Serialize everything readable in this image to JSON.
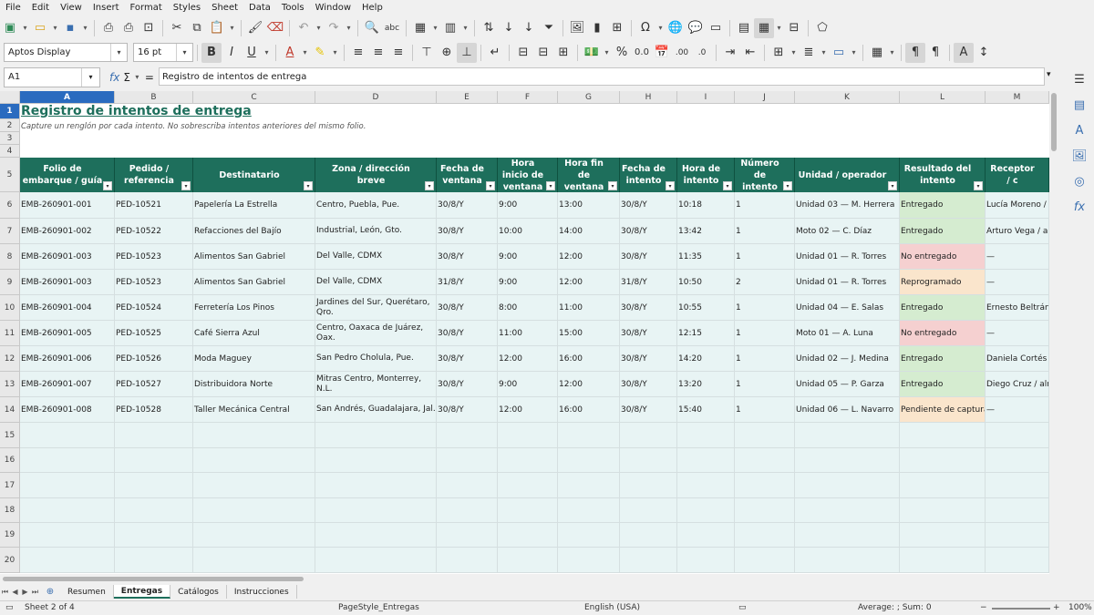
{
  "menu": [
    "File",
    "Edit",
    "View",
    "Insert",
    "Format",
    "Styles",
    "Sheet",
    "Data",
    "Tools",
    "Window",
    "Help"
  ],
  "formatting": {
    "font_name": "Aptos Display",
    "font_size": "16 pt",
    "bold_label": "B",
    "italic_label": "I",
    "underline_label": "U"
  },
  "formula_bar": {
    "cell_ref": "A1",
    "content": "Registro de intentos de entrega",
    "fx_symbol": "fx",
    "sum_symbol": "Σ",
    "eq_symbol": "="
  },
  "columns": [
    "A",
    "B",
    "C",
    "D",
    "E",
    "F",
    "G",
    "H",
    "I",
    "J",
    "K",
    "L",
    "M"
  ],
  "selected_column": "A",
  "sheet": {
    "title": "Registro de intentos de entrega",
    "subtitle": "Capture un renglón por cada intento. No sobrescriba intentos anteriores del mismo folio.",
    "headers": [
      "Folio de embarque / guía",
      "Pedido / referencia",
      "Destinatario",
      "Zona / dirección breve",
      "Fecha de ventana",
      "Hora inicio de ventana",
      "Hora fin de ventana",
      "Fecha de intento",
      "Hora de intento",
      "Número de intento",
      "Unidad / operador",
      "Resultado del intento",
      "Receptor / c"
    ],
    "rows": [
      [
        "EMB-260901-001",
        "PED-10521",
        "Papelería La Estrella",
        "Centro, Puebla, Pue.",
        "30/8/Y",
        "9:00",
        "13:00",
        "30/8/Y",
        "10:18",
        "1",
        "Unidad 03 — M. Herrera",
        "Entregado",
        "Lucía Moreno / e"
      ],
      [
        "EMB-260901-002",
        "PED-10522",
        "Refacciones del Bajío",
        "Industrial, León, Gto.",
        "30/8/Y",
        "10:00",
        "14:00",
        "30/8/Y",
        "13:42",
        "1",
        "Moto 02 — C. Díaz",
        "Entregado",
        "Arturo Vega / alm"
      ],
      [
        "EMB-260901-003",
        "PED-10523",
        "Alimentos San Gabriel",
        "Del Valle, CDMX",
        "30/8/Y",
        "9:00",
        "12:00",
        "30/8/Y",
        "11:35",
        "1",
        "Unidad 01 — R. Torres",
        "No entregado",
        "—"
      ],
      [
        "EMB-260901-003",
        "PED-10523",
        "Alimentos San Gabriel",
        "Del Valle, CDMX",
        "31/8/Y",
        "9:00",
        "12:00",
        "31/8/Y",
        "10:50",
        "2",
        "Unidad 01 — R. Torres",
        "Reprogramado",
        "—"
      ],
      [
        "EMB-260901-004",
        "PED-10524",
        "Ferretería Los Pinos",
        "Jardines del Sur, Querétaro, Qro.",
        "30/8/Y",
        "8:00",
        "11:00",
        "30/8/Y",
        "10:55",
        "1",
        "Unidad 04 — E. Salas",
        "Entregado",
        "Ernesto Beltrán /"
      ],
      [
        "EMB-260901-005",
        "PED-10525",
        "Café Sierra Azul",
        "Centro, Oaxaca de Juárez, Oax.",
        "30/8/Y",
        "11:00",
        "15:00",
        "30/8/Y",
        "12:15",
        "1",
        "Moto 01 — A. Luna",
        "No entregado",
        "—"
      ],
      [
        "EMB-260901-006",
        "PED-10526",
        "Moda Maguey",
        "San Pedro Cholula, Pue.",
        "30/8/Y",
        "12:00",
        "16:00",
        "30/8/Y",
        "14:20",
        "1",
        "Unidad 02 — J. Medina",
        "Entregado",
        "Daniela Cortés /"
      ],
      [
        "EMB-260901-007",
        "PED-10527",
        "Distribuidora Norte",
        "Mitras Centro, Monterrey, N.L.",
        "30/8/Y",
        "9:00",
        "12:00",
        "30/8/Y",
        "13:20",
        "1",
        "Unidad 05 — P. Garza",
        "Entregado",
        "Diego Cruz / alm"
      ],
      [
        "EMB-260901-008",
        "PED-10528",
        "Taller Mecánica Central",
        "San Andrés, Guadalajara, Jal.",
        "30/8/Y",
        "12:00",
        "16:00",
        "30/8/Y",
        "15:40",
        "1",
        "Unidad 06 — L. Navarro",
        "Pendiente de captura",
        "—"
      ]
    ],
    "result_status": [
      "ok",
      "ok",
      "no",
      "re",
      "ok",
      "no",
      "ok",
      "ok",
      "re"
    ],
    "row_numbers": [
      "1",
      "2",
      "3",
      "4",
      "5",
      "6",
      "7",
      "8",
      "9",
      "10",
      "11",
      "12",
      "13",
      "14",
      "15",
      "16",
      "17",
      "18",
      "19",
      "20"
    ]
  },
  "tabs": [
    "Resumen",
    "Entregas",
    "Catálogos",
    "Instrucciones"
  ],
  "active_tab": "Entregas",
  "status": {
    "sheet": "Sheet 2 of 4",
    "page_style": "PageStyle_Entregas",
    "language": "English (USA)",
    "summary": "Average: ; Sum: 0",
    "zoom": "100%"
  },
  "colors": {
    "header_bg": "#1e6f5c",
    "entregado": "#d5ecd0",
    "no_entregado": "#f5d0d0",
    "reprogramado": "#fae5cc",
    "selection": "#2a6bbf"
  }
}
